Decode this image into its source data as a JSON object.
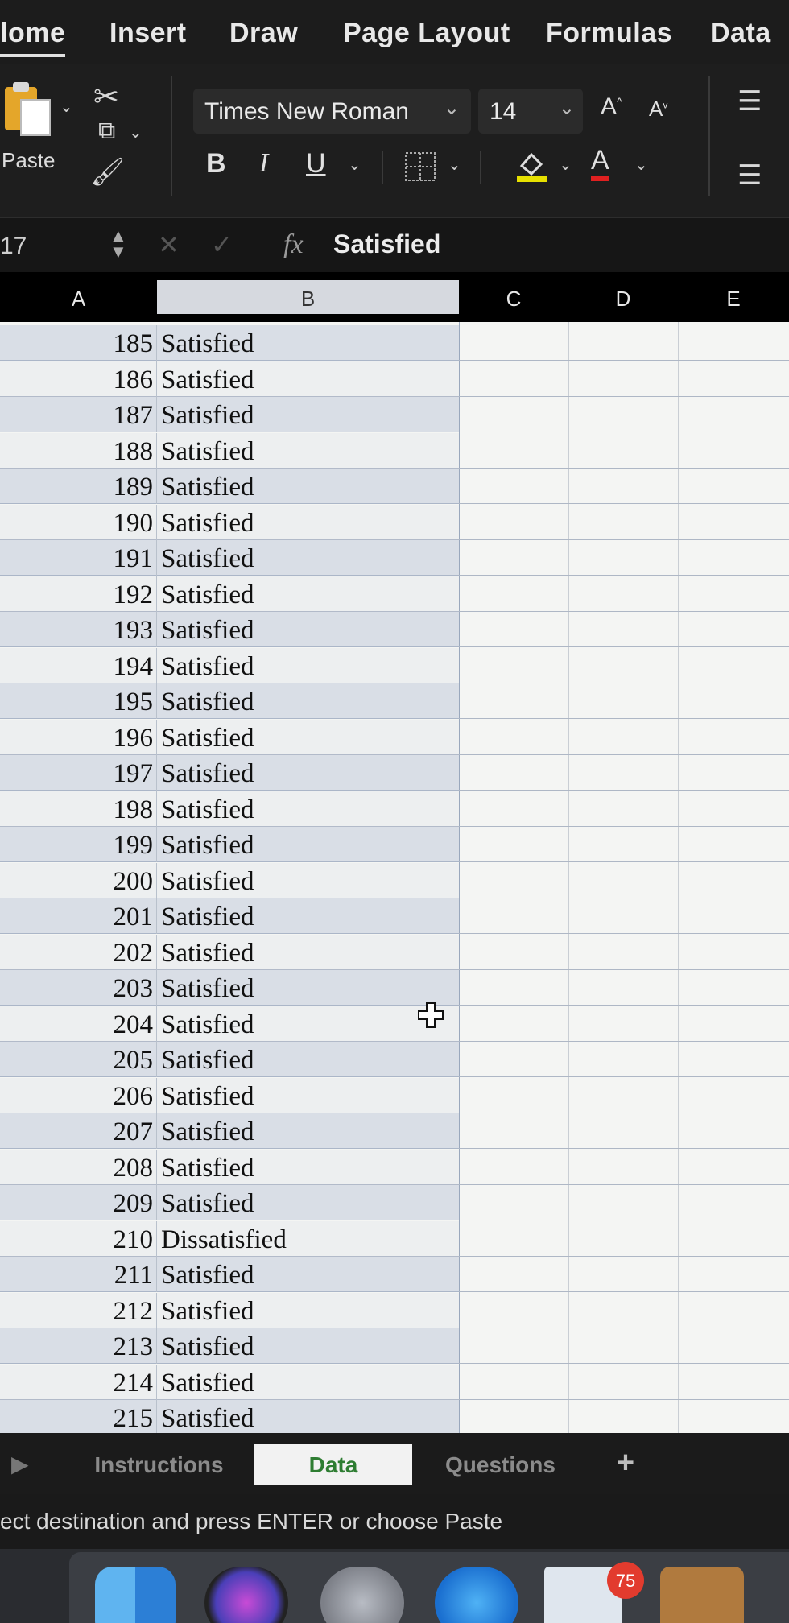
{
  "ribbon_tabs": [
    "lome",
    "Insert",
    "Draw",
    "Page Layout",
    "Formulas",
    "Data"
  ],
  "ribbon": {
    "paste_label": "Paste",
    "font_name": "Times New Roman",
    "font_size": "14",
    "bold": "B",
    "italic": "I",
    "underline": "U",
    "font_color_glyph": "A"
  },
  "formula_bar": {
    "cell_ref": "17",
    "fx": "fx",
    "content": "Satisfied"
  },
  "columns": [
    "A",
    "B",
    "C",
    "D",
    "E"
  ],
  "rows": [
    {
      "num": "185",
      "status": "Satisfied"
    },
    {
      "num": "186",
      "status": "Satisfied"
    },
    {
      "num": "187",
      "status": "Satisfied"
    },
    {
      "num": "188",
      "status": "Satisfied"
    },
    {
      "num": "189",
      "status": "Satisfied"
    },
    {
      "num": "190",
      "status": "Satisfied"
    },
    {
      "num": "191",
      "status": "Satisfied"
    },
    {
      "num": "192",
      "status": "Satisfied"
    },
    {
      "num": "193",
      "status": "Satisfied"
    },
    {
      "num": "194",
      "status": "Satisfied"
    },
    {
      "num": "195",
      "status": "Satisfied"
    },
    {
      "num": "196",
      "status": "Satisfied"
    },
    {
      "num": "197",
      "status": "Satisfied"
    },
    {
      "num": "198",
      "status": "Satisfied"
    },
    {
      "num": "199",
      "status": "Satisfied"
    },
    {
      "num": "200",
      "status": "Satisfied"
    },
    {
      "num": "201",
      "status": "Satisfied"
    },
    {
      "num": "202",
      "status": "Satisfied"
    },
    {
      "num": "203",
      "status": "Satisfied"
    },
    {
      "num": "204",
      "status": "Satisfied"
    },
    {
      "num": "205",
      "status": "Satisfied"
    },
    {
      "num": "206",
      "status": "Satisfied"
    },
    {
      "num": "207",
      "status": "Satisfied"
    },
    {
      "num": "208",
      "status": "Satisfied"
    },
    {
      "num": "209",
      "status": "Satisfied"
    },
    {
      "num": "210",
      "status": "Dissatisfied"
    },
    {
      "num": "211",
      "status": "Satisfied"
    },
    {
      "num": "212",
      "status": "Satisfied"
    },
    {
      "num": "213",
      "status": "Satisfied"
    },
    {
      "num": "214",
      "status": "Satisfied"
    },
    {
      "num": "215",
      "status": "Satisfied"
    }
  ],
  "sheet_tabs": [
    {
      "label": "Instructions",
      "active": false
    },
    {
      "label": "Data",
      "active": true
    },
    {
      "label": "Questions",
      "active": false
    }
  ],
  "add_sheet": "+",
  "status_text": "ect destination and press ENTER or choose Paste",
  "dock": {
    "mail_badge": "75"
  },
  "colors": {
    "ribbon_bg": "#1e1e1e",
    "selection_tint": "#a5b4cd",
    "font_color_red": "#e02020",
    "highlight_yellow": "#e6e000",
    "active_sheet_text": "#2e7d32",
    "badge_red": "#e23b2e"
  }
}
